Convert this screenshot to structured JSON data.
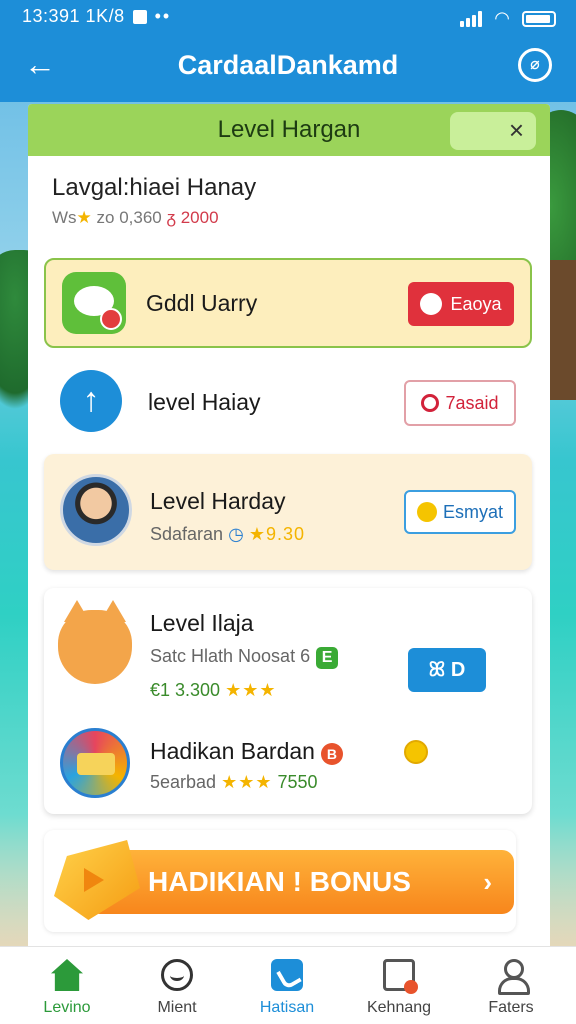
{
  "status_bar": {
    "time": "13:391 1K/8",
    "dots": "••"
  },
  "app_bar": {
    "back_icon": "←",
    "title": "CardaalDankamd",
    "timer_icon": "⌀"
  },
  "level_header": {
    "title": "Level Hargan",
    "close_icon": "×"
  },
  "intro": {
    "heading": "Lavgal:hiaei Hanay",
    "meta_prefix": "Ws",
    "meta_star": "★",
    "meta_mid": "zo 0,360",
    "meta_red": "2000",
    "meta_red_icon": "ᵹ"
  },
  "rows": [
    {
      "title": "Gddl Uarry",
      "button": "Eaoya",
      "icon": "chat-icon"
    },
    {
      "title": "level Haiay",
      "button": "7asaid",
      "icon": "upload-icon",
      "icon_glyph": "↑"
    },
    {
      "title": "Level Harday",
      "meta_text": "Sdafaran",
      "meta_num": "★9.30",
      "button": "Esmyat",
      "icon": "avatar"
    },
    {
      "title": "Level Ilaja",
      "meta_text": "Satc Hlath Noosat 6",
      "meta_badge": "E",
      "meta_num": "€1 3.300",
      "meta_stars": "★★★",
      "button": "ꕤ D",
      "icon": "cat-icon"
    },
    {
      "title": "Hadikan Bardan",
      "title_badge": "B",
      "meta_text": "5earbad",
      "meta_stars": "★★★",
      "meta_num": "7550",
      "icon": "badge-icon"
    }
  ],
  "bonus": {
    "label": "HADIKIAN ! BONUS",
    "chevron": "›"
  },
  "nav": [
    {
      "label": "Levino",
      "icon": "home-icon"
    },
    {
      "label": "Mient",
      "icon": "face-icon"
    },
    {
      "label": "Hatisan",
      "icon": "phone-icon"
    },
    {
      "label": "Kehnang",
      "icon": "clipboard-icon"
    },
    {
      "label": "Faters",
      "icon": "user-icon"
    }
  ],
  "colors": {
    "app_bar": "#1d8ed8",
    "level_header": "#9bd45a",
    "primary_red": "#e0313c",
    "bonus_orange": "#f7861c",
    "nav_active": "#2c9a3a"
  }
}
